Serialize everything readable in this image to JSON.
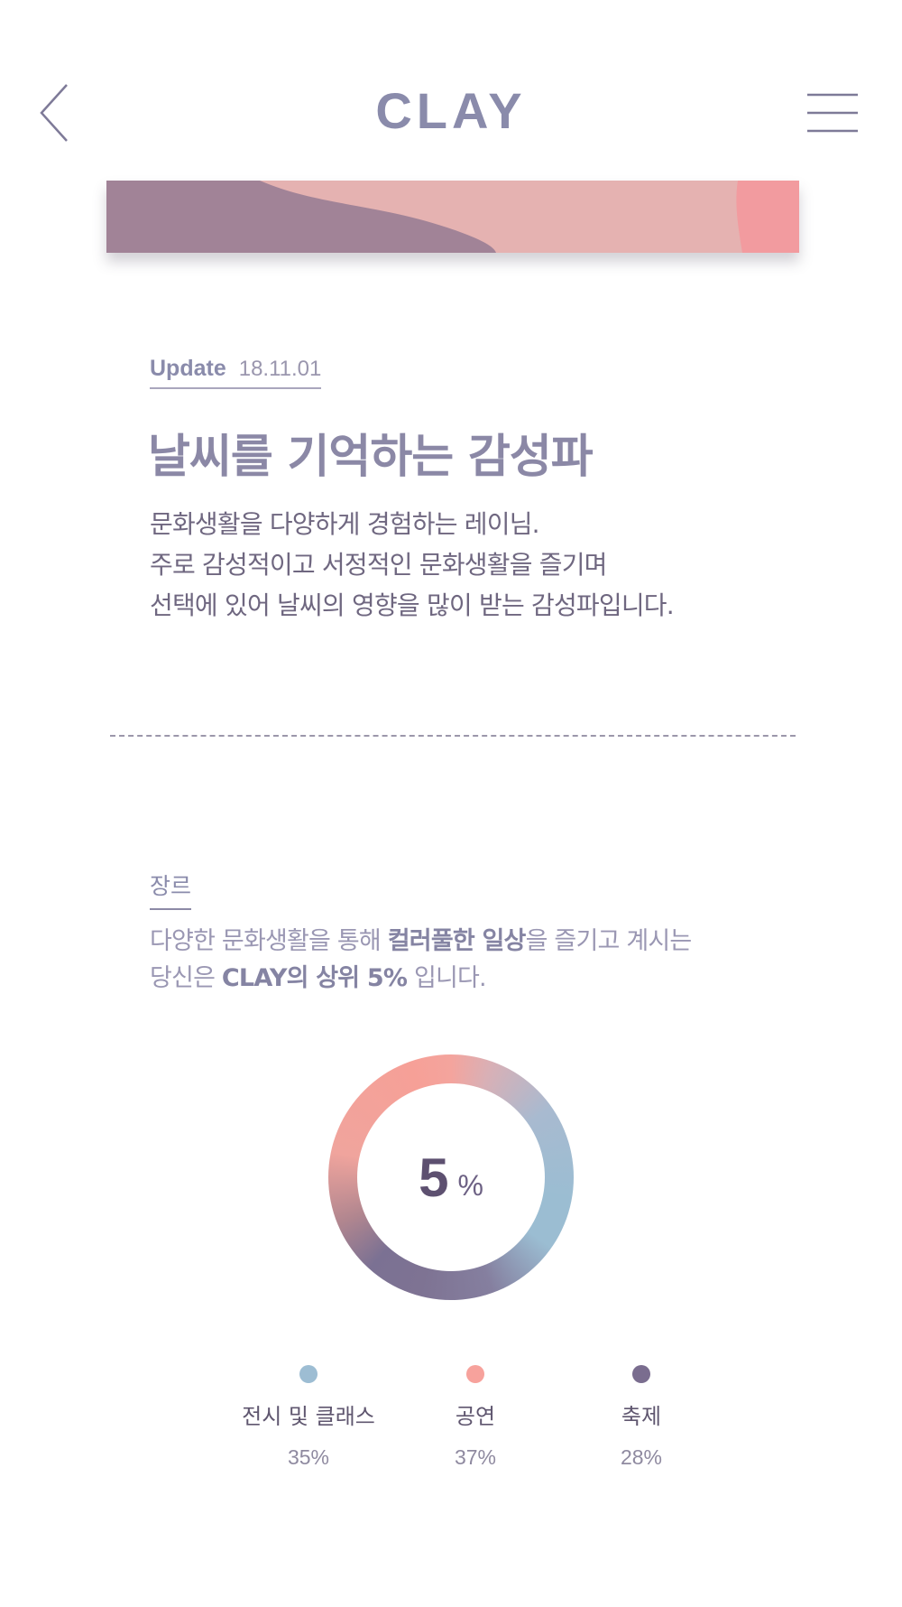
{
  "header": {
    "logo": "CLAY",
    "back_icon": "chevron-left-icon",
    "menu_icon": "hamburger-menu-icon"
  },
  "intro": {
    "update_label": "Update",
    "update_date": "18.11.01",
    "title": "날씨를 기억하는 감성파",
    "description": [
      "문화생활을 다양하게 경험하는 레이님.",
      "주로 감성적이고 서정적인 문화생활을 즐기며",
      "선택에 있어 날씨의 영향을 많이 받는 감성파입니다."
    ]
  },
  "genre": {
    "label": "장르",
    "line1": {
      "before": "다양한 문화생활을 통해 ",
      "bold": "컬러풀한 일상",
      "after": "을 즐기고 계시는"
    },
    "line2": {
      "before": "당신은 ",
      "bold": "CLAY의 상위 5%",
      "after": " 입니다."
    },
    "donut": {
      "value": "5",
      "unit": "%"
    },
    "legend": [
      {
        "name": "전시 및 클래스",
        "percent": "35%",
        "share": 35,
        "color": "#9dbdd3"
      },
      {
        "name": "공연",
        "percent": "37%",
        "share": 37,
        "color": "#f7a29c"
      },
      {
        "name": "축제",
        "percent": "28%",
        "share": 28,
        "color": "#7a6d8f"
      }
    ]
  },
  "colors": {
    "primary": "#8a8bab",
    "text": "#6f6780",
    "blue": "#9dbdd3",
    "coral": "#f7a29c",
    "purple": "#7a6d8f"
  }
}
